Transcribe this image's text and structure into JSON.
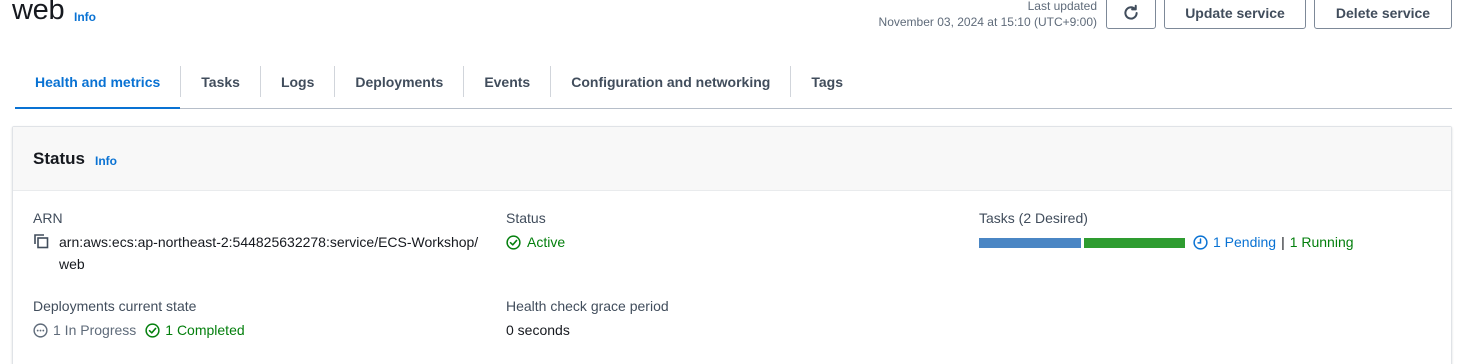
{
  "header": {
    "title": "web",
    "info_label": "Info",
    "last_updated_label": "Last updated",
    "last_updated_value": "November 03, 2024 at 15:10 (UTC+9:00)",
    "update_button": "Update service",
    "delete_button": "Delete service"
  },
  "tabs": [
    {
      "label": "Health and metrics",
      "active": true
    },
    {
      "label": "Tasks"
    },
    {
      "label": "Logs"
    },
    {
      "label": "Deployments"
    },
    {
      "label": "Events"
    },
    {
      "label": "Configuration and networking"
    },
    {
      "label": "Tags"
    }
  ],
  "status_panel": {
    "title": "Status",
    "info_label": "Info",
    "arn_label": "ARN",
    "arn_value": "arn:aws:ecs:ap-northeast-2:544825632278:service/ECS-Workshop/web",
    "status_label": "Status",
    "status_value": "Active",
    "tasks_label": "Tasks (2 Desired)",
    "tasks_pending": "1 Pending",
    "tasks_separator": "|",
    "tasks_running": "1 Running",
    "tasks_pending_fraction": 0.5,
    "tasks_running_fraction": 0.5,
    "deployments_label": "Deployments current state",
    "deployments_in_progress": "1 In Progress",
    "deployments_completed": "1 Completed",
    "grace_label": "Health check grace period",
    "grace_value": "0 seconds"
  },
  "colors": {
    "link_blue": "#0972d3",
    "success_green": "#037f0c",
    "pending_bar": "#4a86c4",
    "running_bar": "#2e9c30"
  },
  "icons": {
    "refresh": "refresh-icon",
    "copy": "copy-icon",
    "status": "check-circle-icon",
    "pending": "clock-icon",
    "in_progress": "ellipsis-circle-icon",
    "completed": "check-circle-icon"
  }
}
